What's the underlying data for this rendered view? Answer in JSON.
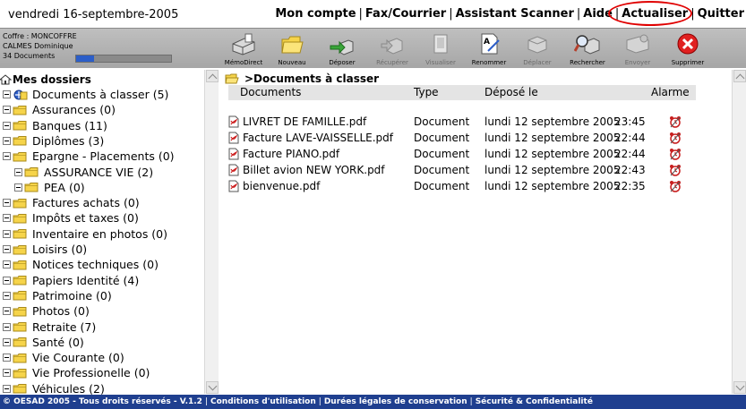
{
  "header": {
    "date": "vendredi 16-septembre-2005",
    "nav": [
      "Mon compte",
      "Fax/Courrier",
      "Assistant Scanner",
      "Aide",
      "Actualiser",
      "Quitter"
    ]
  },
  "user": {
    "vault": "Coffre : MONCOFFRE",
    "name": "CALMES Dominique",
    "doc_count": "34 Documents",
    "quota_fraction": 0.19
  },
  "toolbar": {
    "buttons": [
      {
        "label": "MémoDirect",
        "icon": "scanner-icon",
        "enabled": true
      },
      {
        "label": "Nouveau",
        "icon": "folder-icon",
        "enabled": true
      },
      {
        "label": "Déposer",
        "icon": "deposit-arrow-icon",
        "enabled": true
      },
      {
        "label": "Récupérer",
        "icon": "retrieve-icon",
        "enabled": false
      },
      {
        "label": "Visualiser",
        "icon": "view-document-icon",
        "enabled": false
      },
      {
        "label": "Renommer",
        "icon": "rename-icon",
        "enabled": true
      },
      {
        "label": "Déplacer",
        "icon": "move-icon",
        "enabled": false
      },
      {
        "label": "Rechercher",
        "icon": "search-icon",
        "enabled": true
      },
      {
        "label": "Envoyer",
        "icon": "send-icon",
        "enabled": false
      },
      {
        "label": "Supprimer",
        "icon": "delete-icon",
        "enabled": true
      }
    ]
  },
  "sidebar": {
    "root": "Mes dossiers",
    "items": [
      {
        "label": "Documents à classer (5)",
        "level": 0,
        "special": true
      },
      {
        "label": "Assurances (0)",
        "level": 0
      },
      {
        "label": "Banques (11)",
        "level": 0
      },
      {
        "label": "Diplômes (3)",
        "level": 0
      },
      {
        "label": "Epargne - Placements (0)",
        "level": 0
      },
      {
        "label": "ASSURANCE VIE (2)",
        "level": 1
      },
      {
        "label": "PEA (0)",
        "level": 1
      },
      {
        "label": "Factures achats (0)",
        "level": 0
      },
      {
        "label": "Impôts et taxes (0)",
        "level": 0
      },
      {
        "label": "Inventaire en photos (0)",
        "level": 0
      },
      {
        "label": "Loisirs (0)",
        "level": 0
      },
      {
        "label": "Notices techniques (0)",
        "level": 0
      },
      {
        "label": "Papiers Identité (4)",
        "level": 0
      },
      {
        "label": "Patrimoine (0)",
        "level": 0
      },
      {
        "label": "Photos (0)",
        "level": 0
      },
      {
        "label": "Retraite (7)",
        "level": 0
      },
      {
        "label": "Santé (0)",
        "level": 0
      },
      {
        "label": "Vie Courante (0)",
        "level": 0
      },
      {
        "label": "Vie Professionelle (0)",
        "level": 0
      },
      {
        "label": "Véhicules (2)",
        "level": 0
      }
    ]
  },
  "main": {
    "breadcrumb": ">Documents à classer",
    "columns": [
      "Documents",
      "Type",
      "Déposé le",
      "Alarme"
    ],
    "rows": [
      {
        "name": "LIVRET DE FAMILLE.pdf",
        "type": "Document",
        "date": "lundi 12 septembre 2005",
        "time": "23:45"
      },
      {
        "name": "Facture LAVE-VAISSELLE.pdf",
        "type": "Document",
        "date": "lundi 12 septembre 2005",
        "time": "22:44"
      },
      {
        "name": "Facture PIANO.pdf",
        "type": "Document",
        "date": "lundi 12 septembre 2005",
        "time": "22:44"
      },
      {
        "name": "Billet avion NEW YORK.pdf",
        "type": "Document",
        "date": "lundi 12 septembre 2005",
        "time": "22:43"
      },
      {
        "name": "bienvenue.pdf",
        "type": "Document",
        "date": "lundi 12 septembre 2005",
        "time": "22:35"
      }
    ]
  },
  "footer": {
    "copyright": "© OESAD 2005 - Tous droits réservés - V.1.2",
    "links": [
      "Conditions d'utilisation",
      "Durées légales de conservation",
      "Sécurité & Confidentialité"
    ]
  },
  "colors": {
    "footer_bg": "#1f3f8f",
    "quota_fill": "#2c5ec8",
    "highlight": "#e00000",
    "folder": "#f6d44a"
  }
}
